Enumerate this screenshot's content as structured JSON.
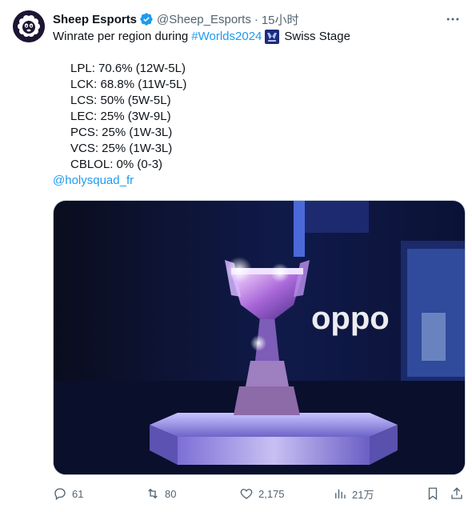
{
  "tweet": {
    "author": {
      "name": "Sheep Esports",
      "handle": "@Sheep_Esports",
      "time": "15小时",
      "separator": "·"
    },
    "text_intro": "Winrate per region during",
    "hashtag": "#Worlds2024",
    "text_suffix": "Swiss Stage",
    "stats": [
      "LPL: 70.6% (12W-5L)",
      "LCK: 68.8% (11W-5L)",
      "LCS: 50% (5W-5L)",
      "LEC: 25% (3W-9L)",
      "PCS: 25% (1W-3L)",
      "VCS: 25% (1W-3L)",
      "CBLOL: 0% (0-3)"
    ],
    "mention": "@holysquad_fr",
    "media": {
      "backdrop_logo_text": "oppo"
    }
  },
  "actions": {
    "replies": "61",
    "retweets": "80",
    "likes": "2,175",
    "views": "21万"
  },
  "colors": {
    "accent": "#1d9bf0",
    "secondary_text": "#536471",
    "primary_text": "#0f1419"
  }
}
